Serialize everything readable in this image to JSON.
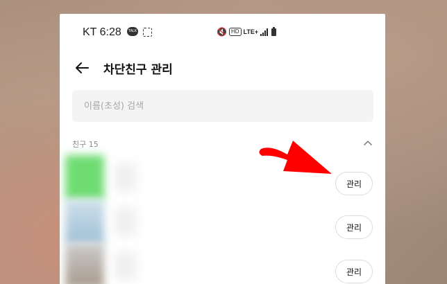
{
  "status_bar": {
    "carrier_time": "KT 6:28",
    "talk_badge": "TALK",
    "hd_label": "HD",
    "network_label": "LTE+"
  },
  "header": {
    "title": "차단친구 관리"
  },
  "search": {
    "placeholder": "이름(초성) 검색"
  },
  "friends_section": {
    "label": "친구 15"
  },
  "friends": [
    {
      "manage_label": "관리"
    },
    {
      "manage_label": "관리"
    },
    {
      "manage_label": "관리"
    }
  ],
  "icons": {
    "back": "back-arrow-icon",
    "collapse": "chevron-up-icon",
    "annotation": "red-arrow-icon"
  },
  "colors": {
    "accent_arrow": "#ff0000",
    "search_bg": "#f4f4f4"
  }
}
